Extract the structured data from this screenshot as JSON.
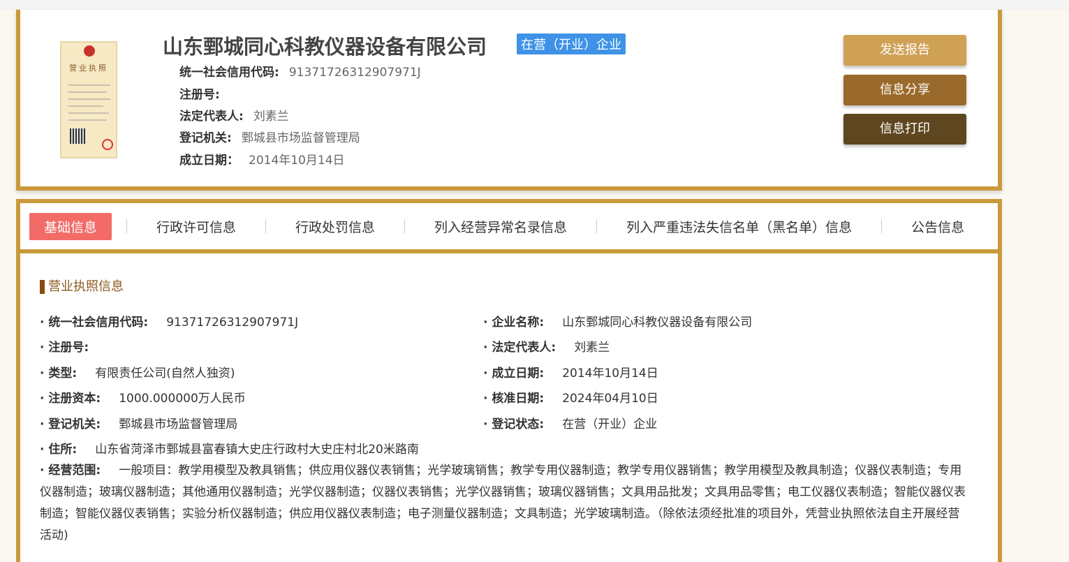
{
  "company": {
    "name": "山东鄄城同心科教仪器设备有限公司",
    "status_badge": "在营（开业）企业",
    "license_image_label": "营业执照",
    "summary": [
      {
        "label": "统一社会信用代码:",
        "value": "91371726312907971J"
      },
      {
        "label": "注册号:",
        "value": ""
      },
      {
        "label": "法定代表人:",
        "value": "刘素兰"
      },
      {
        "label": "登记机关:",
        "value": "鄄城县市场监督管理局"
      },
      {
        "label": "成立日期：",
        "value": "2014年10月14日"
      }
    ]
  },
  "buttons": {
    "send_report": "发送报告",
    "share": "信息分享",
    "print": "信息打印"
  },
  "colors": {
    "gold": "#c99a3b",
    "send": "#cfa155",
    "share": "#9a6a2c",
    "print": "#5e4620",
    "badge": "#3e93e6",
    "active_tab": "#f26b67"
  },
  "tabs": [
    "基础信息",
    "行政许可信息",
    "行政处罚信息",
    "列入经营异常名录信息",
    "列入严重违法失信名单（黑名单）信息",
    "公告信息"
  ],
  "section_title": "营业执照信息",
  "left_fields": [
    {
      "label": "统一社会信用代码:",
      "value": "91371726312907971J"
    },
    {
      "label": "注册号:",
      "value": ""
    },
    {
      "label": "类型:",
      "value": "有限责任公司(自然人独资)"
    },
    {
      "label": "注册资本:",
      "value": "1000.000000万人民币"
    },
    {
      "label": "登记机关:",
      "value": "鄄城县市场监督管理局"
    },
    {
      "label": "住所:",
      "value": "山东省菏泽市鄄城县富春镇大史庄行政村大史庄村北20米路南"
    }
  ],
  "right_fields": [
    {
      "label": "企业名称:",
      "value": "山东鄄城同心科教仪器设备有限公司"
    },
    {
      "label": "法定代表人:",
      "value": "刘素兰"
    },
    {
      "label": "成立日期:",
      "value": "2014年10月14日"
    },
    {
      "label": "核准日期:",
      "value": "2024年04月10日"
    },
    {
      "label": "登记状态:",
      "value": "在营（开业）企业"
    }
  ],
  "scope": {
    "label": "经营范围:",
    "value": "一般项目：教学用模型及教具销售；供应用仪器仪表销售；光学玻璃销售；教学专用仪器制造；教学专用仪器销售；教学用模型及教具制造；仪器仪表制造；专用仪器制造；玻璃仪器制造；其他通用仪器制造；光学仪器制造；仪器仪表销售；光学仪器销售；玻璃仪器销售；文具用品批发；文具用品零售；电工仪器仪表制造；智能仪器仪表制造；智能仪器仪表销售；实验分析仪器制造；供应用仪器仪表制造；电子测量仪器制造；文具制造；光学玻璃制造。（除依法须经批准的项目外，凭营业执照依法自主开展经营活动)"
  }
}
